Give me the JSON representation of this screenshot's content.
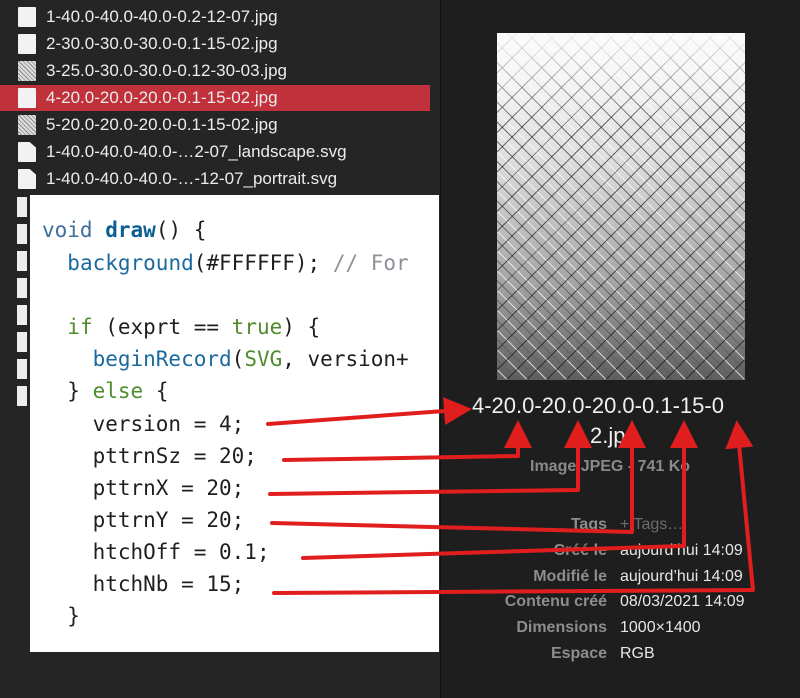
{
  "file_list": {
    "items": [
      {
        "name": "1-40.0-40.0-40.0-0.2-12-07.jpg",
        "icon": "image-file-icon",
        "selected": false
      },
      {
        "name": "2-30.0-30.0-30.0-0.1-15-02.jpg",
        "icon": "image-file-icon",
        "selected": false
      },
      {
        "name": "3-25.0-30.0-30.0-0.12-30-03.jpg",
        "icon": "image-thumbnail-icon",
        "selected": false
      },
      {
        "name": "4-20.0-20.0-20.0-0.1-15-02.jpg",
        "icon": "image-file-icon",
        "selected": true
      },
      {
        "name": "5-20.0-20.0-20.0-0.1-15-02.jpg",
        "icon": "image-thumbnail-icon",
        "selected": false
      },
      {
        "name": "1-40.0-40.0-40.0-…2-07_landscape.svg",
        "icon": "document-icon",
        "selected": false
      },
      {
        "name": "1-40.0-40.0-40.0-…-12-07_portrait.svg",
        "icon": "document-icon",
        "selected": false
      }
    ],
    "selected_color": "#c0313b"
  },
  "preview": {
    "title_line1": "4-20.0-20.0-20.0-0.1-15-0",
    "title_line2": "2.jpg",
    "subtitle": "Image JPEG - 741 Ko",
    "metadata": [
      {
        "key": "Tags",
        "value": "+ Tags…"
      },
      {
        "key": "Créé le",
        "value": "aujourd’hui 14:09"
      },
      {
        "key": "Modifié le",
        "value": "aujourd’hui 14:09"
      },
      {
        "key": "Contenu créé",
        "value": "08/03/2021 14:09"
      },
      {
        "key": "Dimensions",
        "value": "1000×1400"
      },
      {
        "key": "Espace",
        "value": "RGB"
      }
    ]
  },
  "code": {
    "l1_type": "void",
    "l1_fn": "draw",
    "l1_rest": "() {",
    "l2_call": "background",
    "l2_args": "(#FFFFFF); ",
    "l2_comment": "// For",
    "l4_kw": "if",
    "l4_mid": " (exprt == ",
    "l4_val": "true",
    "l4_end": ") {",
    "l5_call": "beginRecord",
    "l5_paren": "(",
    "l5_arg": "SVG",
    "l5_rest": ", version+",
    "l6_brace": "} ",
    "l6_kw": "else",
    "l6_end": " {",
    "assignments": [
      "version = 4;",
      "pttrnSz = 20;",
      "pttrnX = 20;",
      "pttrnY = 20;",
      "htchOff = 0.1;",
      "htchNb = 15;"
    ],
    "close": "}"
  },
  "annotation_color": "#e01e1e"
}
